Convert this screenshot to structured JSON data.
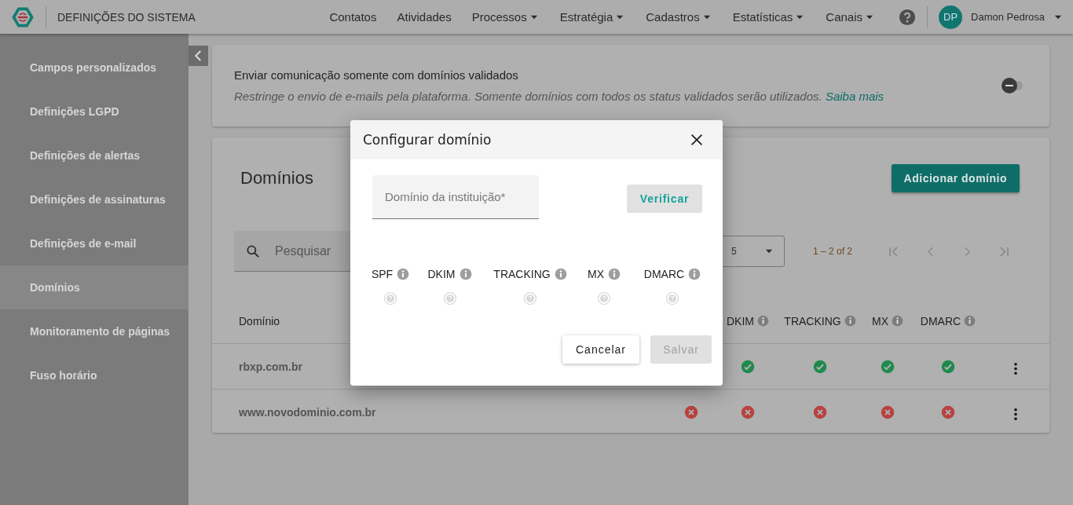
{
  "header": {
    "title": "DEFINIÇÕES DO SISTEMA",
    "nav": [
      {
        "label": "Contatos",
        "dropdown": false
      },
      {
        "label": "Atividades",
        "dropdown": false
      },
      {
        "label": "Processos",
        "dropdown": true
      },
      {
        "label": "Estratégia",
        "dropdown": true
      },
      {
        "label": "Cadastros",
        "dropdown": true
      },
      {
        "label": "Estatísticas",
        "dropdown": true
      },
      {
        "label": "Canais",
        "dropdown": true
      }
    ],
    "user": {
      "initials": "DP",
      "name": "Damon Pedrosa"
    }
  },
  "sidebar": {
    "items": [
      {
        "label": "Campos personalizados",
        "selected": false
      },
      {
        "label": "Definições LGPD",
        "selected": false
      },
      {
        "label": "Definições de alertas",
        "selected": false
      },
      {
        "label": "Definições de assinaturas",
        "selected": false
      },
      {
        "label": "Definições de e-mail",
        "selected": false
      },
      {
        "label": "Domínios",
        "selected": true
      },
      {
        "label": "Monitoramento de páginas",
        "selected": false
      },
      {
        "label": "Fuso horário",
        "selected": false
      }
    ]
  },
  "setting": {
    "title": "Enviar comunicação somente com domínios validados",
    "description": "Restringe o envio de e-mails pela plataforma. Somente domínios com todos os status validados serão utilizados.",
    "link": "Saiba mais",
    "on": false
  },
  "domains": {
    "title": "Domínios",
    "add_button": "Adicionar domínio",
    "search": {
      "placeholder": "Pesquisar"
    },
    "page_size": "5",
    "range": "1 – 2 of 2",
    "columns": [
      {
        "label": "Domínio"
      },
      {
        "label": "DKIM"
      },
      {
        "label": "TRACKING"
      },
      {
        "label": "MX"
      },
      {
        "label": "DMARC"
      }
    ],
    "rows": [
      {
        "domain": "rbxp.com.br",
        "statuses": [
          {
            "kind": "valid"
          },
          {
            "kind": "valid"
          },
          {
            "kind": "valid"
          },
          {
            "kind": "valid"
          }
        ]
      },
      {
        "domain": "www.novodominio.com.br",
        "statuses": [
          {
            "kind": "invalid"
          },
          {
            "kind": "invalid"
          },
          {
            "kind": "invalid"
          },
          {
            "kind": "invalid"
          },
          {
            "kind": "invalid"
          }
        ]
      }
    ]
  },
  "dialog": {
    "title": "Configurar domínio",
    "field": {
      "placeholder": "Domínio da instituição*"
    },
    "verify_button": "Verificar",
    "checks": [
      {
        "label": "SPF",
        "kind": "pending"
      },
      {
        "label": "DKIM",
        "kind": "pending"
      },
      {
        "label": "TRACKING",
        "kind": "pending"
      },
      {
        "label": "MX",
        "kind": "pending"
      },
      {
        "label": "DMARC",
        "kind": "pending"
      }
    ],
    "cancel_button": "Cancelar",
    "save_button": {
      "label": "Salvar",
      "disabled": true
    }
  }
}
